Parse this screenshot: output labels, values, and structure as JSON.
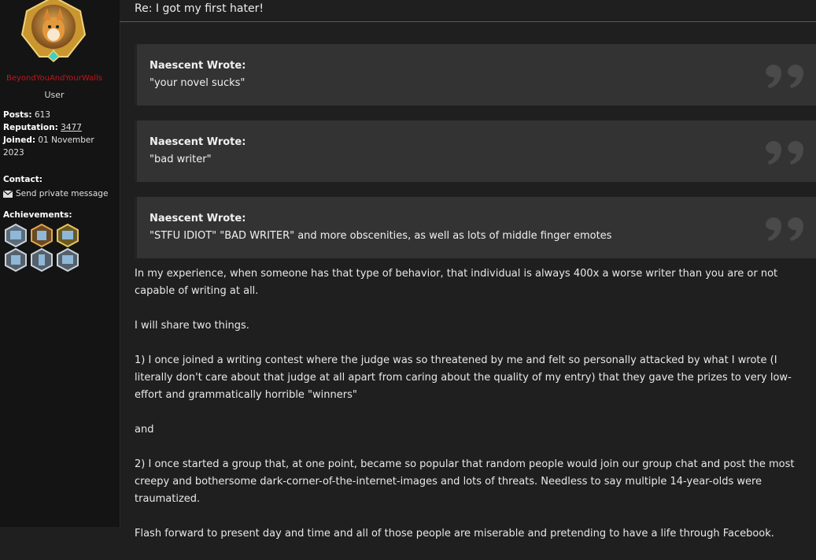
{
  "user": {
    "username": "BeyondYouAndYourWalls",
    "role": "User",
    "posts_label": "Posts:",
    "posts": "613",
    "reputation_label": "Reputation:",
    "reputation": "3477",
    "joined_label": "Joined:",
    "joined": "01 November 2023",
    "contact_label": "Contact:",
    "pm_label": "Send private message",
    "achievements_label": "Achievements:"
  },
  "post": {
    "title": "Re: I got my first hater!",
    "quotes": [
      {
        "author": "Naescent Wrote:",
        "text": "\"your novel sucks\""
      },
      {
        "author": "Naescent Wrote:",
        "text": "\"bad writer\""
      },
      {
        "author": "Naescent Wrote:",
        "text": "\"STFU IDIOT\" \"BAD WRITER\" and more obscenities, as well as lots of middle finger emotes"
      }
    ],
    "paragraphs": [
      "In my experience, when someone has that type of behavior, that individual is always 400x a worse writer than you are or not capable of writing at all.",
      "I will share two things.",
      "1) I once joined a writing contest where the judge was so threatened by me and felt so personally attacked by what I wrote (I literally don't care about that judge at all apart from caring about the quality of my entry) that they gave the prizes to very low-effort and grammatically horrible \"winners\"",
      "and",
      "2) I once started a group that, at one point, became so popular that random people would join our group chat and post the most creepy and bothersome dark-corner-of-the-internet-images and lots of threats. Needless to say multiple 14-year-olds were traumatized.",
      "Flash forward to present day and time and all of those people are miserable and pretending to have a life through Facebook."
    ]
  },
  "colors": {
    "username": "#c0161a",
    "quote_bg": "#333333",
    "page_bg": "#1f1f1f",
    "sidebar_bg": "#141414"
  },
  "icons": [
    "avatar-image",
    "envelope-icon",
    "achievement-badge-icon",
    "quote-mark-icon"
  ]
}
